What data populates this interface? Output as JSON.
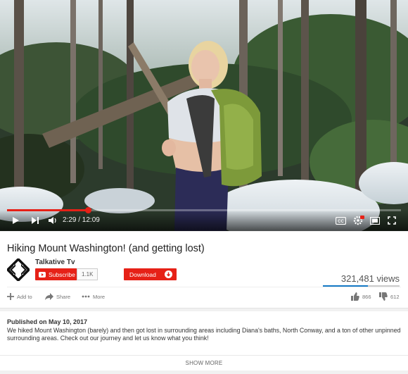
{
  "player": {
    "time_current": "2:29",
    "time_total": "12:09",
    "time_display": "2:29 / 12:09",
    "progress_fraction": 0.205,
    "controls": [
      "play-icon",
      "next-icon",
      "volume-icon",
      "captions-icon",
      "settings-icon",
      "miniplayer-icon",
      "fullscreen-icon"
    ],
    "hd_badge": "HD"
  },
  "video": {
    "title": "Hiking Mount Washington! (and getting lost)",
    "views": "321,481 views",
    "likes": "866",
    "dislikes": "612",
    "like_fraction": 0.586
  },
  "channel": {
    "name": "Talkative Tv",
    "subscribe_label": "Subscribe",
    "subscriber_count": "1.1K",
    "download_label": "Download"
  },
  "actions": {
    "add_to": "Add to",
    "share": "Share",
    "more": "More"
  },
  "description": {
    "published": "Published on May 10, 2017",
    "text": "We hiked Mount Washington (barely) and then got lost in surrounding areas including Diana's baths, North Conway, and a ton of other unpinned surrounding areas. Check out our journey and let us know what you think!",
    "show_more": "SHOW MORE"
  },
  "colors": {
    "accent": "#e62117",
    "views_bar": "#167ac6"
  }
}
